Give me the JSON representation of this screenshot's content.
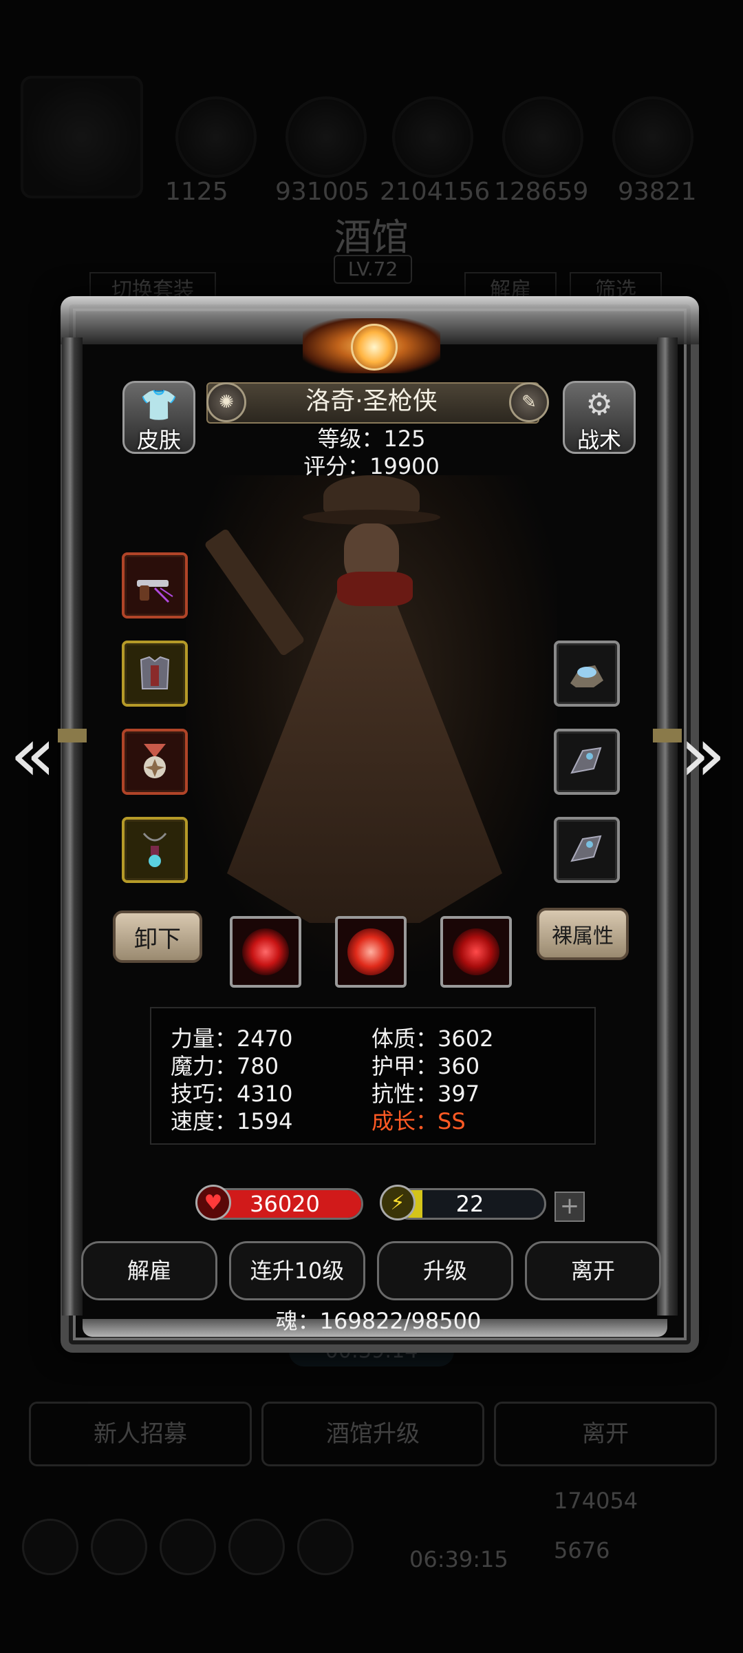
{
  "background": {
    "resources": [
      "1125",
      "931005",
      "2104156",
      "128659",
      "93821"
    ],
    "title": "酒馆",
    "level": "LV.72",
    "buttons": {
      "switch_set": "切换套装",
      "dismiss": "解雇",
      "filter": "筛选"
    },
    "timer": "00:39:14",
    "bottom_buttons": [
      "新人招募",
      "酒馆升级",
      "离开"
    ],
    "gold": "174054",
    "gems": "5676",
    "bottom_timer": "06:39:15"
  },
  "hero": {
    "name": "洛奇·圣枪侠",
    "level_text": "等级：125",
    "score_text": "评分：19900",
    "skin_label": "皮肤",
    "tactics_label": "战术",
    "unequip_label": "卸下",
    "base_attr_label": "裸属性"
  },
  "stats": [
    {
      "label": "力量：2470",
      "growth": false
    },
    {
      "label": "体质：3602",
      "growth": false
    },
    {
      "label": "魔力：780",
      "growth": false
    },
    {
      "label": "护甲：360",
      "growth": false
    },
    {
      "label": "技巧：4310",
      "growth": false
    },
    {
      "label": "抗性：397",
      "growth": false
    },
    {
      "label": "速度：1594",
      "growth": false
    },
    {
      "label": "成长：SS",
      "growth": true
    }
  ],
  "hp": {
    "value": "36020",
    "fill_fraction": 1.0,
    "color": "#d11a1a"
  },
  "energy": {
    "value": "22",
    "fill_fraction": 0.18,
    "color": "#d4c41a"
  },
  "actions": {
    "dismiss": "解雇",
    "level_up_10": "连升10级",
    "level_up": "升级",
    "leave": "离开"
  },
  "soul_text": "魂：169822/98500",
  "icons": {
    "left_arrow": "chevron-left-icon",
    "right_arrow": "chevron-right-icon"
  }
}
